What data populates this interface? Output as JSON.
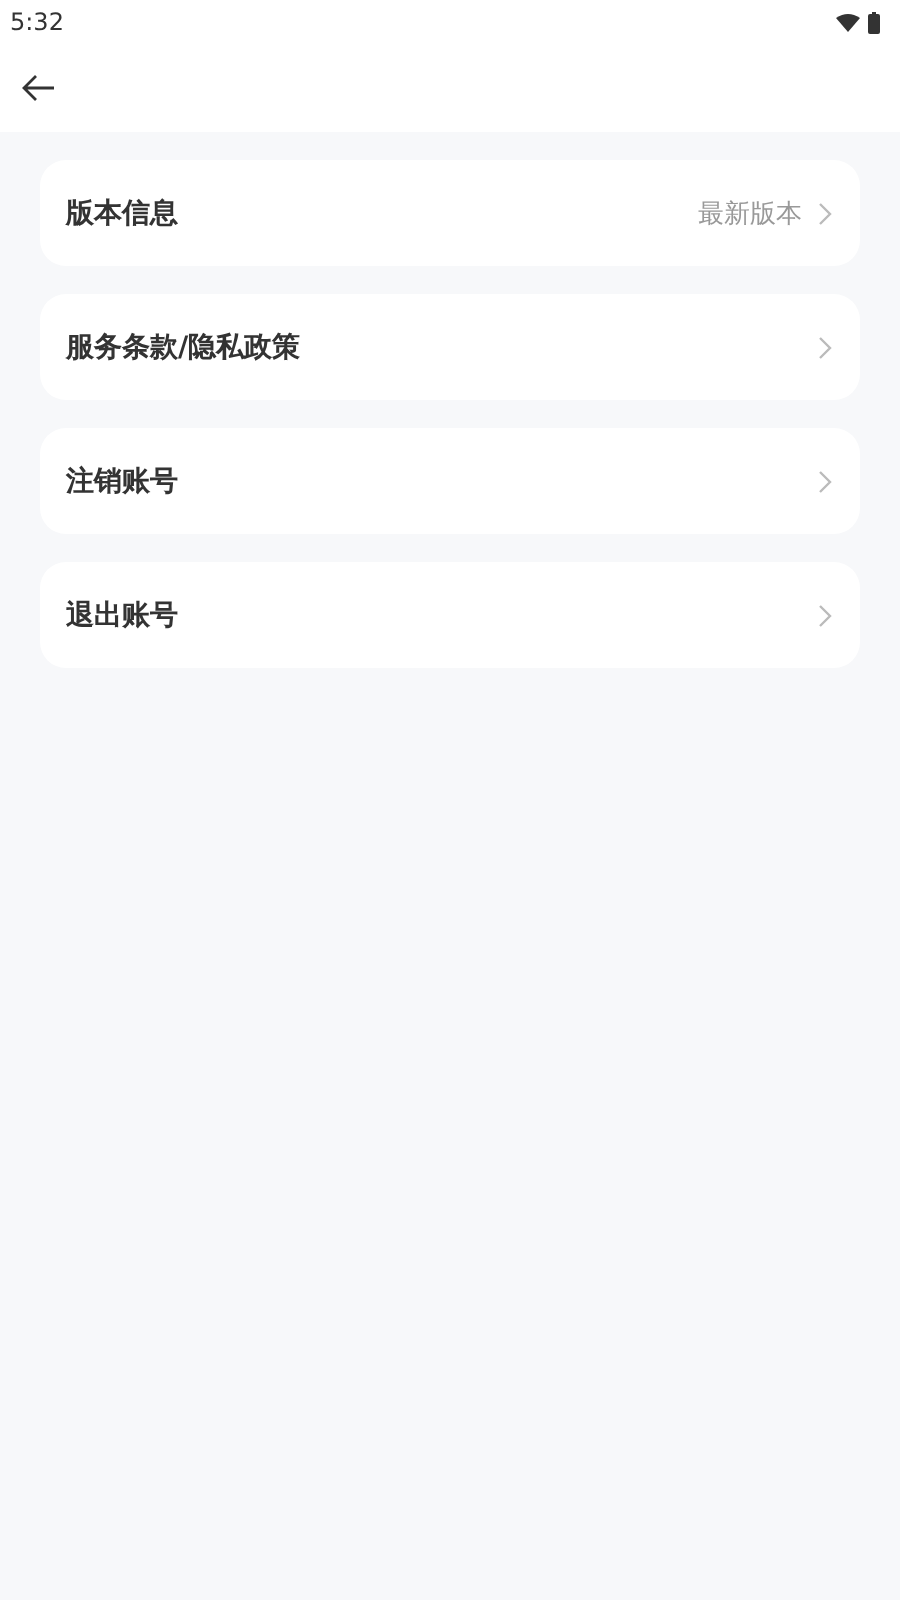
{
  "status_bar": {
    "time": "5:32"
  },
  "items": [
    {
      "label": "版本信息",
      "value": "最新版本"
    },
    {
      "label": "服务条款/隐私政策"
    },
    {
      "label": "注销账号"
    },
    {
      "label": "退出账号"
    }
  ]
}
